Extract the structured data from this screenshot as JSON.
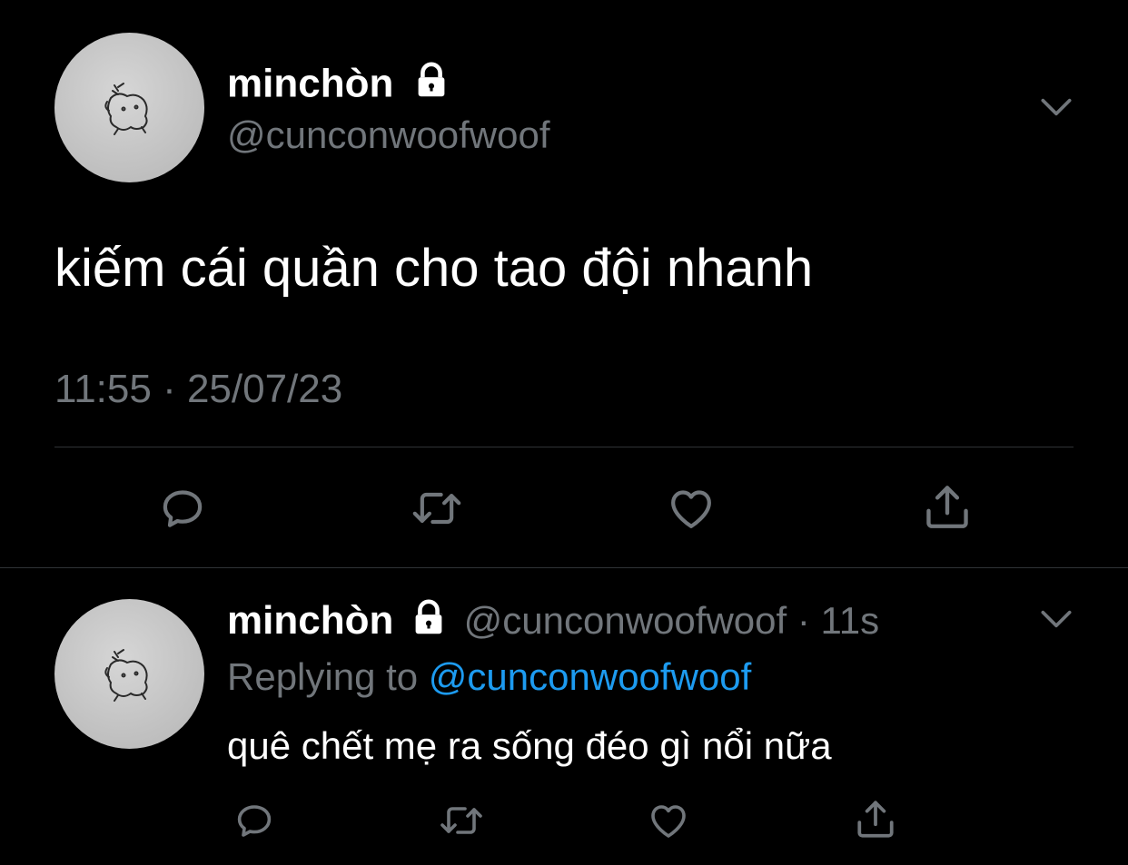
{
  "main_tweet": {
    "display_name": "minchòn",
    "handle": "@cunconwoofwoof",
    "text": "kiếm cái quần cho tao đội nhanh",
    "timestamp": "11:55 · 25/07/23",
    "protected_icon": "lock-icon",
    "menu_icon": "chevron-down-icon",
    "actions": [
      "reply-icon",
      "retweet-icon",
      "like-icon",
      "share-icon"
    ]
  },
  "reply_tweet": {
    "display_name": "minchòn",
    "handle": "@cunconwoofwoof",
    "separator": "·",
    "time": "11s",
    "replying_prefix": "Replying to",
    "replying_handle": "@cunconwoofwoof",
    "text": "quê chết mẹ ra sống đéo gì nổi nữa",
    "protected_icon": "lock-icon",
    "menu_icon": "chevron-down-icon",
    "actions": [
      "reply-icon",
      "retweet-icon",
      "like-icon",
      "share-icon"
    ]
  },
  "colors": {
    "background": "#000000",
    "text": "#ffffff",
    "muted": "#71767b",
    "link": "#1d9bf0",
    "divider": "#2f3336",
    "icon": "#71767b"
  }
}
